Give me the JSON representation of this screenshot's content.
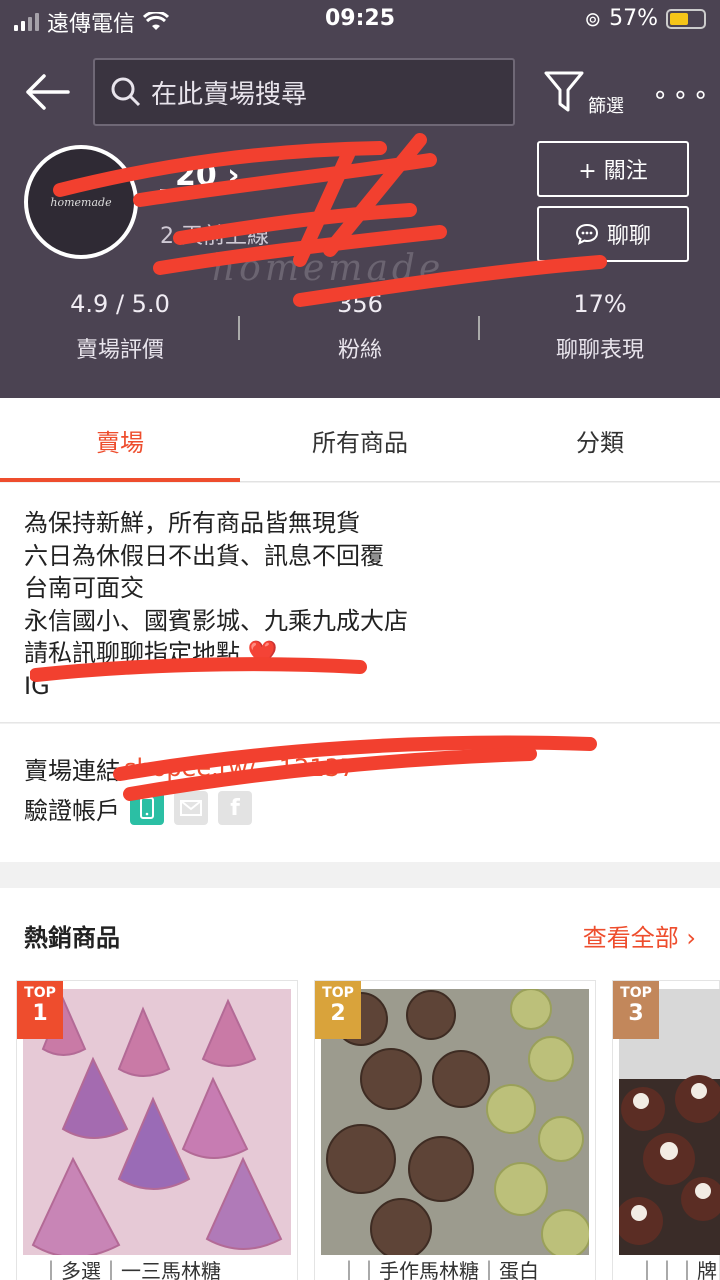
{
  "status_bar": {
    "carrier": "遠傳電信",
    "time": "09:25",
    "battery": "57%",
    "battery_level": 0.57
  },
  "search": {
    "placeholder": "在此賣場搜尋"
  },
  "filter": {
    "label": "篩選"
  },
  "more": {
    "label": "∘∘∘"
  },
  "shop": {
    "avatar_text": "homemade",
    "name": "_20",
    "name_chevron": "›",
    "last_online": "2 天前上線",
    "watermark": "homemade"
  },
  "buttons": {
    "follow": "+ 關注",
    "chat": "聊聊"
  },
  "stats": [
    {
      "value": "4.9 / 5.0",
      "label": "賣場評價"
    },
    {
      "value": "356",
      "label": "粉絲"
    },
    {
      "value": "17%",
      "label": "聊聊表現"
    }
  ],
  "tabs": [
    "賣場",
    "所有商品",
    "分類"
  ],
  "description": [
    "為保持新鮮，所有商品皆無現貨",
    "六日為休假日不出貨、訊息不回覆",
    "台南可面交",
    "永信國小、國賓影城、九乘九成大店",
    "請私訊聊聊指定地點 ❤️",
    "IG"
  ],
  "links": {
    "shop_link_label": "賣場連結",
    "shop_link_value": "shopee.tw/...12137",
    "verified_label": "驗證帳戶"
  },
  "hot": {
    "title": "熱銷商品",
    "view_all": "查看全部 ›",
    "items": [
      {
        "badge_top": "TOP",
        "rank": "1",
        "name": "｜多選｜一三馬林糖"
      },
      {
        "badge_top": "TOP",
        "rank": "2",
        "name": "｜｜手作馬林糖｜蛋白"
      },
      {
        "badge_top": "TOP",
        "rank": "3",
        "name": "｜｜｜牌"
      }
    ]
  },
  "colors": {
    "accent": "#ee4d2d",
    "header_bg": "#4b4352",
    "badge_gold": "#d9a33b",
    "badge_bronze": "#c2875b"
  }
}
